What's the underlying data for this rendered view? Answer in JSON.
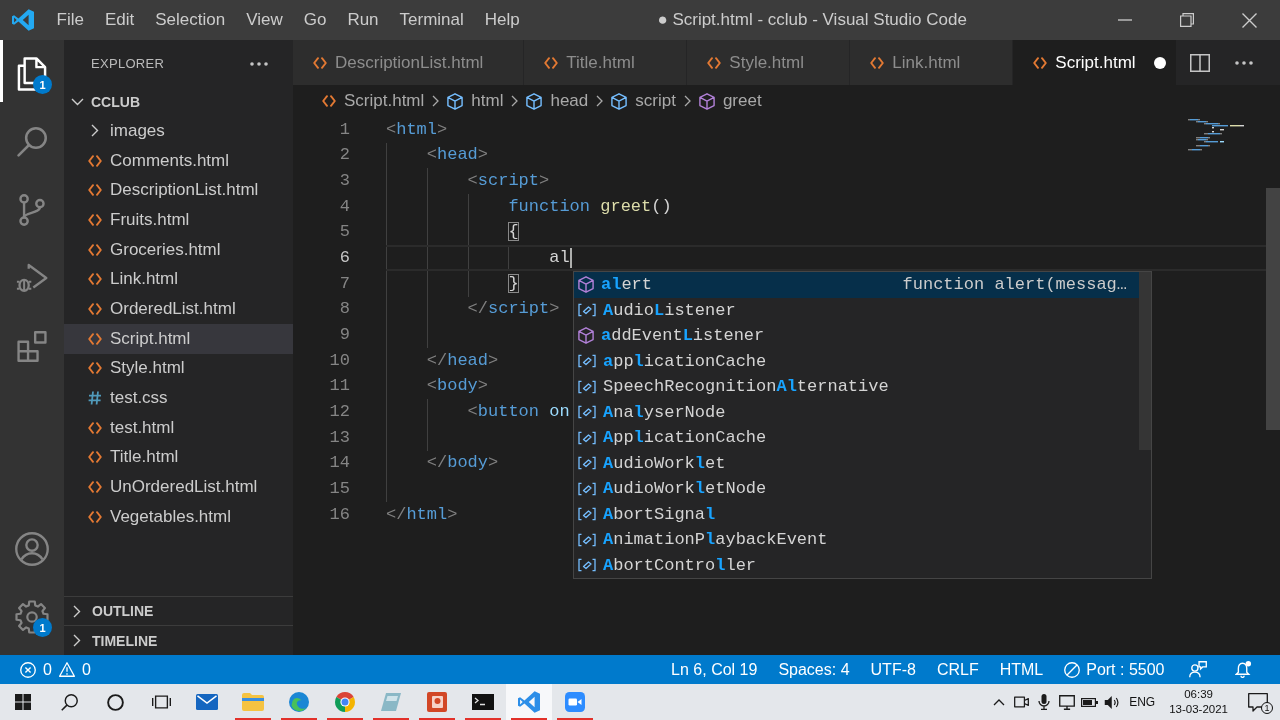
{
  "title_bar": {
    "menu": [
      "File",
      "Edit",
      "Selection",
      "View",
      "Go",
      "Run",
      "Terminal",
      "Help"
    ],
    "title": "● Script.html - cclub - Visual Studio Code"
  },
  "activity_bar": {
    "top": [
      {
        "kind": "explorer",
        "selected": true,
        "badge": "1"
      },
      {
        "kind": "search",
        "selected": false
      },
      {
        "kind": "source-control",
        "selected": false
      },
      {
        "kind": "run",
        "selected": false
      },
      {
        "kind": "extensions",
        "selected": false
      }
    ],
    "bottom": [
      {
        "kind": "accounts"
      },
      {
        "kind": "manage",
        "badge": "1"
      }
    ]
  },
  "sidebar": {
    "title": "EXPLORER",
    "folder": {
      "name": "CCLUB",
      "expanded": true,
      "children": [
        {
          "name": "images",
          "kind": "folder",
          "expanded": false,
          "selected": false
        },
        {
          "name": "Comments.html",
          "kind": "html",
          "selected": false
        },
        {
          "name": "DescriptionList.html",
          "kind": "html",
          "selected": false
        },
        {
          "name": "Fruits.html",
          "kind": "html",
          "selected": false
        },
        {
          "name": "Groceries.html",
          "kind": "html",
          "selected": false
        },
        {
          "name": "Link.html",
          "kind": "html",
          "selected": false
        },
        {
          "name": "OrderedList.html",
          "kind": "html",
          "selected": false
        },
        {
          "name": "Script.html",
          "kind": "html",
          "selected": true
        },
        {
          "name": "Style.html",
          "kind": "html",
          "selected": false
        },
        {
          "name": "test.css",
          "kind": "css",
          "selected": false
        },
        {
          "name": "test.html",
          "kind": "html",
          "selected": false
        },
        {
          "name": "Title.html",
          "kind": "html",
          "selected": false
        },
        {
          "name": "UnOrderedList.html",
          "kind": "html",
          "selected": false
        },
        {
          "name": "Vegetables.html",
          "kind": "html",
          "selected": false
        }
      ]
    },
    "sections": [
      {
        "name": "OUTLINE",
        "expanded": false
      },
      {
        "name": "TIMELINE",
        "expanded": false
      }
    ]
  },
  "editor": {
    "tabs": [
      {
        "label": "DescriptionList.html",
        "selected": false,
        "modified": false
      },
      {
        "label": "Title.html",
        "selected": false,
        "modified": false
      },
      {
        "label": "Style.html",
        "selected": false,
        "modified": false
      },
      {
        "label": "Link.html",
        "selected": false,
        "modified": false
      },
      {
        "label": "Script.html",
        "selected": true,
        "modified": true
      }
    ],
    "breadcrumbs": [
      {
        "label": "Script.html",
        "kind": "file"
      },
      {
        "label": "html",
        "kind": "element"
      },
      {
        "label": "head",
        "kind": "element"
      },
      {
        "label": "script",
        "kind": "element"
      },
      {
        "label": "greet",
        "kind": "function"
      }
    ],
    "lines": [
      {
        "number": "1",
        "caret": false,
        "tokens": [
          {
            "text": "<",
            "kind": "punct"
          },
          {
            "text": "html",
            "kind": "tag"
          },
          {
            "text": ">",
            "kind": "punct"
          }
        ]
      },
      {
        "number": "2",
        "caret": false,
        "tokens": [
          {
            "text": "    <",
            "kind": "punct"
          },
          {
            "text": "head",
            "kind": "tag"
          },
          {
            "text": ">",
            "kind": "punct"
          }
        ]
      },
      {
        "number": "3",
        "caret": false,
        "tokens": [
          {
            "text": "        <",
            "kind": "punct"
          },
          {
            "text": "script",
            "kind": "tag"
          },
          {
            "text": ">",
            "kind": "punct"
          }
        ]
      },
      {
        "number": "4",
        "caret": false,
        "tokens": [
          {
            "text": "            function",
            "kind": "keyword"
          },
          {
            "text": " greet",
            "kind": "function"
          },
          {
            "text": "()",
            "kind": "plain"
          }
        ]
      },
      {
        "number": "5",
        "caret": false,
        "tokens": [
          {
            "text": "            {",
            "kind": "matched-brace"
          }
        ]
      },
      {
        "number": "6",
        "caret": true,
        "tokens": [
          {
            "text": "                al",
            "kind": "plain"
          }
        ]
      },
      {
        "number": "7",
        "caret": false,
        "tokens": [
          {
            "text": "            }",
            "kind": "matched-brace"
          }
        ]
      },
      {
        "number": "8",
        "caret": false,
        "tokens": [
          {
            "text": "        </",
            "kind": "punct"
          },
          {
            "text": "script",
            "kind": "tag"
          },
          {
            "text": ">",
            "kind": "punct"
          }
        ]
      },
      {
        "number": "9",
        "caret": false
      },
      {
        "number": "10",
        "caret": false,
        "tokens": [
          {
            "text": "    </",
            "kind": "punct"
          },
          {
            "text": "head",
            "kind": "tag"
          },
          {
            "text": ">",
            "kind": "punct"
          }
        ]
      },
      {
        "number": "11",
        "caret": false,
        "tokens": [
          {
            "text": "    <",
            "kind": "punct"
          },
          {
            "text": "body",
            "kind": "tag"
          },
          {
            "text": ">",
            "kind": "punct"
          }
        ]
      },
      {
        "number": "12",
        "caret": false,
        "tokens": [
          {
            "text": "        <",
            "kind": "punct"
          },
          {
            "text": "button",
            "kind": "tag"
          },
          {
            "text": " on",
            "kind": "attr"
          }
        ]
      },
      {
        "number": "13",
        "caret": false
      },
      {
        "number": "14",
        "caret": false,
        "tokens": [
          {
            "text": "    </",
            "kind": "punct"
          },
          {
            "text": "body",
            "kind": "tag"
          },
          {
            "text": ">",
            "kind": "punct"
          }
        ]
      },
      {
        "number": "15",
        "caret": false
      },
      {
        "number": "16",
        "caret": false,
        "tokens": [
          {
            "text": "</",
            "kind": "punct"
          },
          {
            "text": "html",
            "kind": "tag"
          },
          {
            "text": ">",
            "kind": "punct"
          }
        ]
      }
    ],
    "suggestions": [
      {
        "label": "**al**ert",
        "kind": "method",
        "selected": true,
        "detail": "function alert(messag…"
      },
      {
        "label": "**A**udio**L**istener",
        "kind": "variable",
        "selected": false
      },
      {
        "label": "**a**ddEvent**L**istener",
        "kind": "method",
        "selected": false
      },
      {
        "label": "**a**pp**l**icationCache",
        "kind": "variable",
        "selected": false
      },
      {
        "label": "SpeechRecognition**Al**ternative",
        "kind": "variable",
        "selected": false
      },
      {
        "label": "**A**na**l**yserNode",
        "kind": "variable",
        "selected": false
      },
      {
        "label": "**A**pp**l**icationCache",
        "kind": "variable",
        "selected": false
      },
      {
        "label": "**A**udioWork**l**et",
        "kind": "variable",
        "selected": false
      },
      {
        "label": "**A**udioWork**l**etNode",
        "kind": "variable",
        "selected": false
      },
      {
        "label": "**A**bortSigna**l**",
        "kind": "variable",
        "selected": false
      },
      {
        "label": "**A**nimationP**l**aybackEvent",
        "kind": "variable",
        "selected": false
      },
      {
        "label": "**A**bortContro**l**ler",
        "kind": "variable",
        "selected": false
      }
    ]
  },
  "status_bar": {
    "errors": "0",
    "warnings": "0",
    "items": [
      "Ln 6, Col 19",
      "Spaces: 4",
      "UTF-8",
      "CRLF",
      "HTML"
    ],
    "port": "Port : 5500"
  },
  "taskbar": {
    "apps": [
      {
        "kind": "mail",
        "running": false,
        "selected": false
      },
      {
        "kind": "files",
        "running": true,
        "selected": false
      },
      {
        "kind": "edge",
        "running": true,
        "selected": false
      },
      {
        "kind": "chrome",
        "running": true,
        "selected": false
      },
      {
        "kind": "tile",
        "running": true,
        "selected": false
      },
      {
        "kind": "slides",
        "running": true,
        "selected": false
      },
      {
        "kind": "terminal",
        "running": true,
        "selected": false
      },
      {
        "kind": "code",
        "running": true,
        "selected": true
      },
      {
        "kind": "video",
        "running": true,
        "selected": false
      }
    ],
    "tray": {
      "language": "ENG",
      "time": "06:39",
      "date": "13-03-2021",
      "notifications": "1"
    }
  }
}
